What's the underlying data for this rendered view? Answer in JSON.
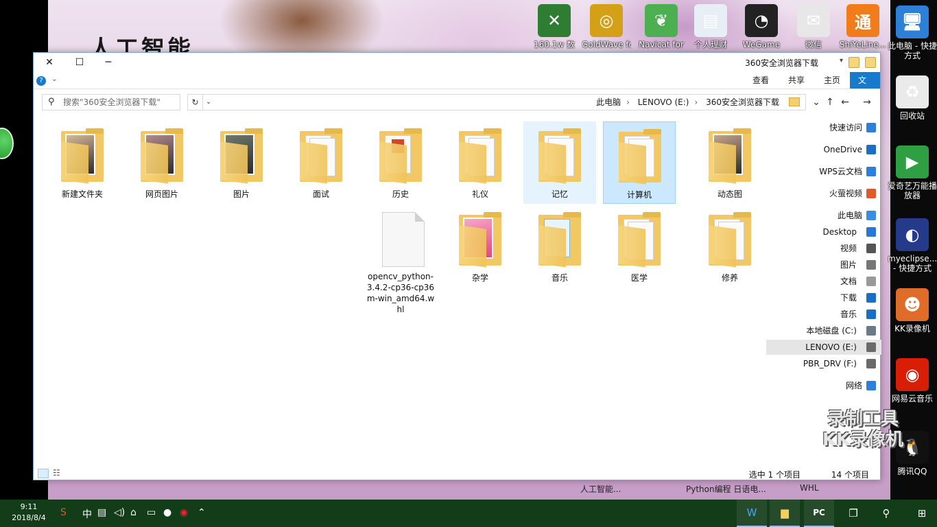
{
  "desktop": {
    "wallpaper_title": "人工智能",
    "bottom_labels": [
      "人工智能...",
      "Python编程 日语电...",
      "WHL"
    ],
    "top_icons": [
      {
        "label": "160.1w 数",
        "color": "#2e7d32",
        "glyph": "✕"
      },
      {
        "label": "GoldWave for",
        "color": "#d4a017",
        "glyph": "◎"
      },
      {
        "label": "Navicat for",
        "color": "#4caf50",
        "glyph": "❦"
      },
      {
        "label": "个人理财",
        "color": "#e8eef5",
        "glyph": "▤"
      },
      {
        "label": "WeGame",
        "color": "#222222",
        "glyph": "◔"
      },
      {
        "label": "微信",
        "color": "#e7e7e7",
        "glyph": "✉"
      },
      {
        "label": "ShiYeLine...",
        "color": "#f07c1b",
        "glyph": "通"
      }
    ],
    "right_icons": [
      {
        "label": "此电脑 - 快捷方式",
        "color": "#2d7fd8",
        "glyph": "🖥"
      },
      {
        "label": "回收站",
        "color": "#eaeaea",
        "glyph": "♻"
      },
      {
        "label": "爱奇艺万能播放器",
        "color": "#2ea043",
        "glyph": "▶"
      },
      {
        "label": "myeclipse... - 快捷方式",
        "color": "#253a8a",
        "glyph": "◐"
      },
      {
        "label": "KK录像机",
        "color": "#e06c2a",
        "glyph": "☻"
      },
      {
        "label": "网易云音乐",
        "color": "#d81e06",
        "glyph": "◉"
      },
      {
        "label": "腾讯QQ",
        "color": "#111111",
        "glyph": "🐧"
      }
    ]
  },
  "window": {
    "title": "360安全浏览器下载",
    "controls": {
      "close": "✕",
      "maximize": "☐",
      "minimize": "─"
    },
    "ribbon_tabs": [
      "文件",
      "主页",
      "共享",
      "查看"
    ],
    "search_placeholder": "搜索\"360安全浏览器下载\"",
    "breadcrumb": [
      "此电脑",
      "LENOVO (E:)",
      "360安全浏览器下载"
    ],
    "nav_pane": [
      {
        "label": "快速访问",
        "color": "#2d7fd8"
      },
      {
        "label": "OneDrive",
        "color": "#1b6fc2"
      },
      {
        "label": "WPS云文档",
        "color": "#2d7fd8"
      },
      {
        "label": "火萤视频",
        "color": "#e05a2b"
      },
      {
        "label": "此电脑",
        "color": "#3b8de0"
      },
      {
        "label": "Desktop",
        "color": "#2b78d4"
      },
      {
        "label": "视频",
        "color": "#555555"
      },
      {
        "label": "图片",
        "color": "#777777"
      },
      {
        "label": "文档",
        "color": "#999999"
      },
      {
        "label": "下载",
        "color": "#1b6fc2"
      },
      {
        "label": "音乐",
        "color": "#1b6fc2"
      },
      {
        "label": "本地磁盘 (C:)",
        "color": "#6a7a8a"
      },
      {
        "label": "LENOVO (E:)",
        "color": "#6a6a6a"
      },
      {
        "label": "PBR_DRV (F:)",
        "color": "#6a6a6a"
      },
      {
        "label": "网络",
        "color": "#2d7fd8"
      }
    ],
    "items_row1": [
      {
        "name": "动态图",
        "kind": "photo",
        "accent": "#c8a48a"
      },
      {
        "name": "计算机",
        "kind": "docs",
        "state": "selected"
      },
      {
        "name": "记忆",
        "kind": "docs",
        "state": "hover"
      },
      {
        "name": "礼仪",
        "kind": "docs"
      },
      {
        "name": "历史",
        "kind": "ppt"
      },
      {
        "name": "面试",
        "kind": "docs"
      },
      {
        "name": "图片",
        "kind": "photo",
        "accent": "#6d7b6e"
      },
      {
        "name": "网页图片",
        "kind": "photo",
        "accent": "#b38a8e"
      },
      {
        "name": "新建文件夹",
        "kind": "photo",
        "accent": "#d9b99a"
      }
    ],
    "items_row2": [
      {
        "name": "修养",
        "kind": "docs"
      },
      {
        "name": "医学",
        "kind": "docs"
      },
      {
        "name": "音乐",
        "kind": "music"
      },
      {
        "name": "杂学",
        "kind": "pink"
      },
      {
        "name": "opencv_python-3.4.2-cp36-cp36m-win_amd64.whl",
        "kind": "file"
      }
    ],
    "status": {
      "count": "14 个项目",
      "selected": "选中 1 个项目"
    }
  },
  "watermark": {
    "line1": "录制工具",
    "line2": "KK录像机"
  },
  "taskbar": {
    "clock_time": "9:11",
    "clock_date": "2018/8/4",
    "ime": "中",
    "apps": [
      {
        "name": "start",
        "glyph": "⊞"
      },
      {
        "name": "search",
        "glyph": "⚲"
      },
      {
        "name": "task-view",
        "glyph": "❐"
      },
      {
        "name": "pycharm",
        "glyph": "PC"
      },
      {
        "name": "file-explorer",
        "glyph": "▆"
      },
      {
        "name": "wps",
        "glyph": "W"
      }
    ]
  }
}
